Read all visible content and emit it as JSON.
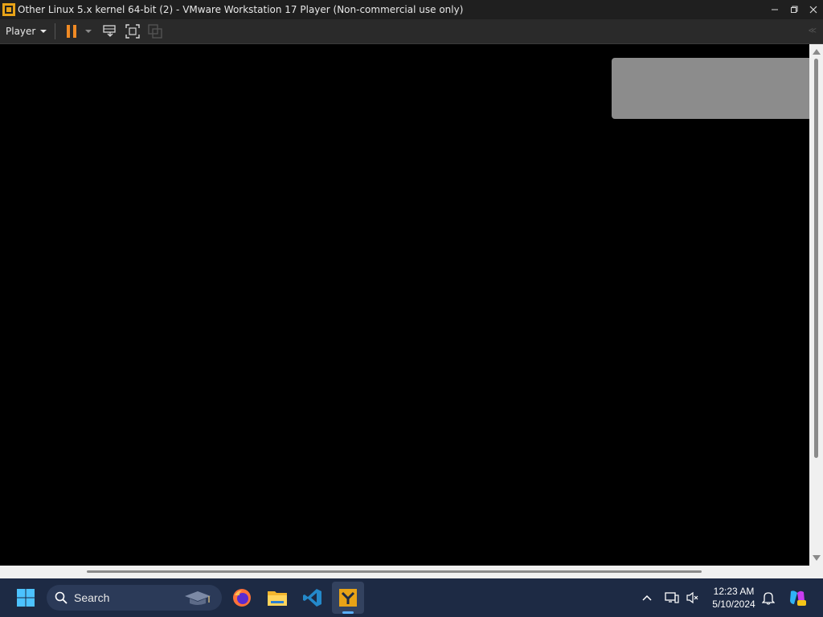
{
  "window": {
    "title": "Other Linux 5.x kernel 64-bit (2) - VMware Workstation 17 Player (Non-commercial use only)",
    "minimize_icon": "minimize-icon",
    "restore_icon": "restore-icon",
    "close_icon": "close-icon"
  },
  "toolbar": {
    "player_label": "Player",
    "icons": [
      "pause-icon",
      "send-ctrl-alt-del-icon",
      "full-screen-icon",
      "unity-icon"
    ]
  },
  "vm": {
    "screen_color": "#000000",
    "notification_color": "#8c8c8c"
  },
  "taskbar": {
    "search_placeholder": "Search",
    "apps": [
      "start-icon",
      "firefox-icon",
      "file-explorer-icon",
      "vscode-icon",
      "vmware-icon"
    ],
    "clock_time": "12:23 AM",
    "clock_date": "5/10/2024",
    "accent": "#5ab0ff"
  }
}
